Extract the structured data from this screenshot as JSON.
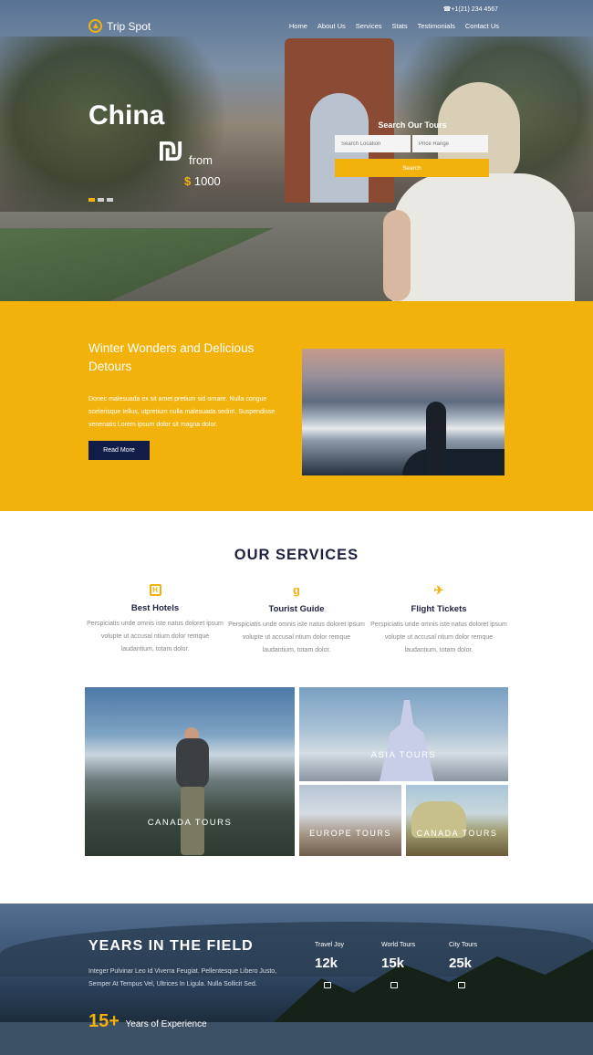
{
  "header": {
    "phone": "☎+1(21) 234 4567",
    "logo_text": "Trip Spot",
    "nav": [
      "Home",
      "About Us",
      "Services",
      "Stats",
      "Testimonials",
      "Contact Us"
    ]
  },
  "hero": {
    "title": "China",
    "symbol": "₪",
    "from": "from",
    "currency": "$",
    "price": "1000",
    "slides": 3,
    "search": {
      "title": "Search Our Tours",
      "location_placeholder": "Search Location",
      "price_placeholder": "Price Range",
      "button": "Search"
    }
  },
  "promo": {
    "title": "Winter Wonders and Delicious Detours",
    "body": "Donec malesuada ex sit amet pretium sid ornare. Nulla congue scelerisque tellus, utpretium nulla malesuada sedint. Suspendisse venenatis Lorem ipsum dolor sit magna dolor.",
    "button": "Read More"
  },
  "services": {
    "title": "OUR SERVICES",
    "items": [
      {
        "icon": "hotel-icon",
        "glyph": "H",
        "title": "Best Hotels",
        "text": "Perspiciatis unde omnis iste natus doloret ipsum volupte ut accusal ntium dolor remque laudantium, totam dolor."
      },
      {
        "icon": "guide-icon",
        "glyph": "g",
        "title": "Tourist Guide",
        "text": "Perspiciatis unde omnis iste natus doloret ipsum volupte ut accusal ntium dolor remque laudantium, totam dolor."
      },
      {
        "icon": "plane-icon",
        "glyph": "✈",
        "title": "Flight Tickets",
        "text": "Perspiciatis unde omnis iste natus doloret ipsum volupte ut accusal ntium dolor remque laudantium, totam dolor."
      }
    ]
  },
  "tours": {
    "canada_big": "CANADA TOURS",
    "asia": "ASIA TOURS",
    "europe": "EUROPE TOURS",
    "canada_small": "CANADA TOURS"
  },
  "stats": {
    "title": "YEARS IN THE FIELD",
    "text": "Integer Pulvinar Leo Id Viverra Feugiat. Pellentesque Libero Justo, Semper At Tempus Vel, Ultrices In Ligula. Nulla Sollicit Sed.",
    "years_num": "15+",
    "years_label": "Years of Experience",
    "items": [
      {
        "label": "Travel Joy",
        "value": "12k",
        "icon": "users-icon"
      },
      {
        "label": "World Tours",
        "value": "15k",
        "icon": "map-icon"
      },
      {
        "label": "City Tours",
        "value": "25k",
        "icon": "city-icon"
      }
    ]
  },
  "colors": {
    "accent": "#f3b20b",
    "navy": "#121c48",
    "heading": "#1e2240"
  }
}
